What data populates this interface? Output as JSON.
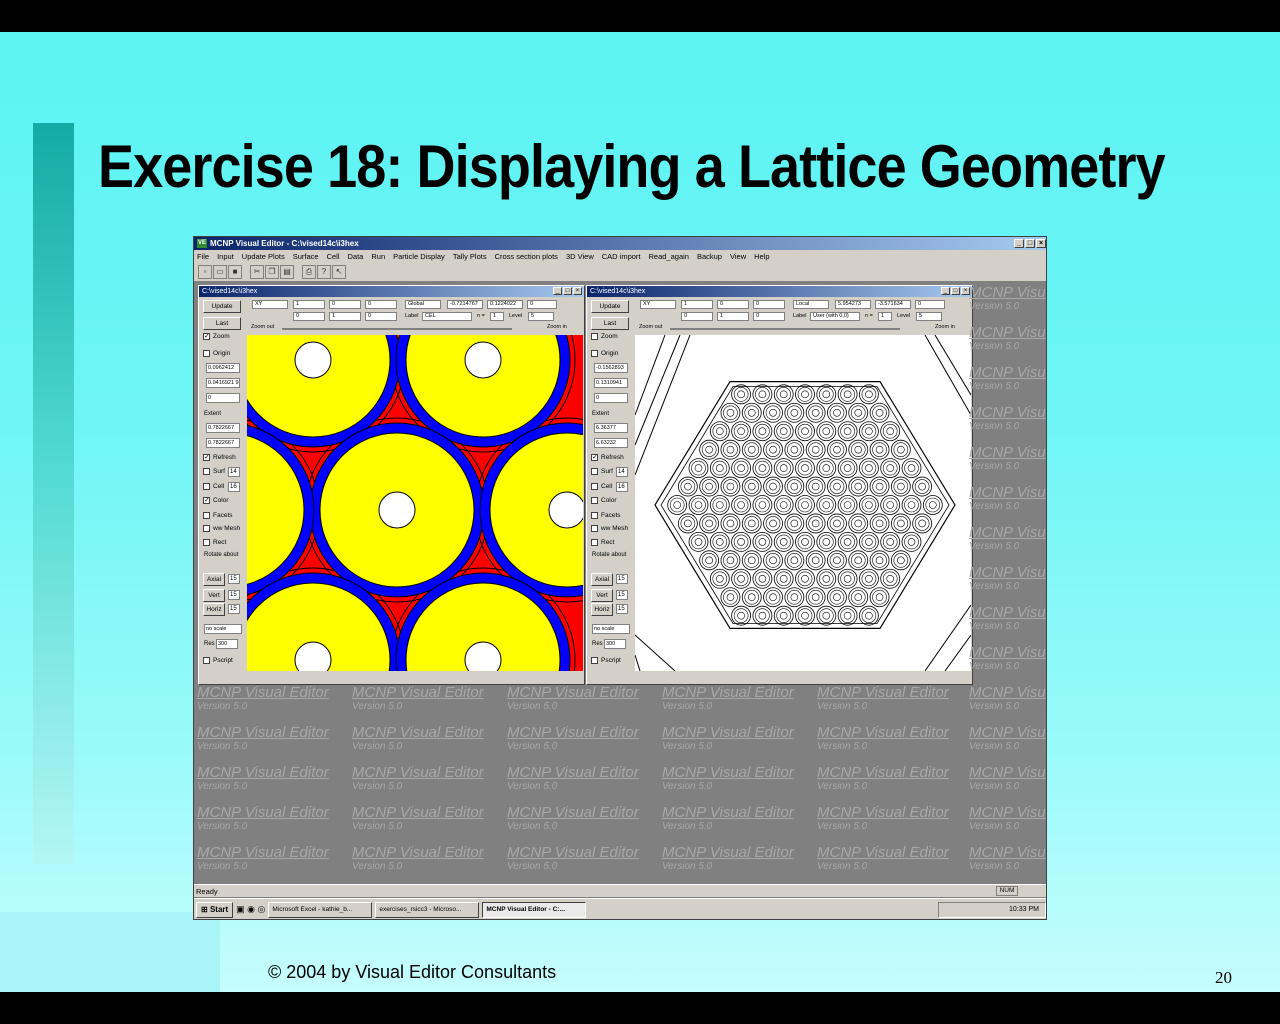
{
  "slide": {
    "title": "Exercise 18:  Displaying a Lattice Geometry",
    "copyright": "© 2004 by Visual Editor Consultants",
    "page_number": "20"
  },
  "app": {
    "title": "MCNP Visual Editor - C:\\vised14c\\i3hex",
    "logo_text": "VE",
    "window_buttons": [
      "_",
      "□",
      "×"
    ],
    "menu": [
      "File",
      "Input",
      "Update Plots",
      "Surface",
      "Cell",
      "Data",
      "Run",
      "Particle Display",
      "Tally Plots",
      "Cross section plots",
      "3D View",
      "CAD import",
      "Read_again",
      "Backup",
      "View",
      "Help"
    ],
    "toolbar_icons": [
      "new-icon",
      "open-icon",
      "save-icon",
      "cut-icon",
      "copy-icon",
      "paste-icon",
      "print-icon",
      "help-icon",
      "context-help-icon"
    ]
  },
  "left_window": {
    "title": "C:\\vised14c\\i3hex",
    "update": "Update",
    "last": "Last",
    "zoom": "Zoom",
    "origin": "Origin",
    "origin_values": [
      "0.0962412",
      "0.0416921 9",
      "0"
    ],
    "extent": "Extent",
    "extent_values": [
      "0.7822667",
      "0.7822667"
    ],
    "refresh": "Refresh",
    "surf": "Surf",
    "surf_val": "14",
    "cell": "Cell",
    "cell_val": "16",
    "color": "Color",
    "facets": "Facets",
    "wwmesh": "ww Mesh",
    "rect": "Rect",
    "rotate": "Rotate about",
    "axial": "Axial",
    "axial_val": "15",
    "vert": "Vert",
    "vert_val": "15",
    "horiz": "Horiz",
    "horiz_val": "15",
    "scale": "no scale",
    "res": "Res",
    "res_val": "300",
    "pscript": "Pscript",
    "plane": "XY",
    "row1": [
      "1",
      "0",
      "0"
    ],
    "row2": [
      "0",
      "1",
      "0"
    ],
    "coord_mode": "Global",
    "coord_vals": [
      "-0.7214767",
      "0.1224022",
      "0"
    ],
    "label_text": "Label",
    "label_val": "CEL",
    "n_label": "n =",
    "n_val": "1",
    "level_label": "Level",
    "level_val": "5",
    "zoom_out": "Zoom out",
    "zoom_in": "Zoom in"
  },
  "right_window": {
    "title": "C:\\vised14c\\i3hex",
    "update": "Update",
    "last": "Last",
    "zoom": "Zoom",
    "origin": "Origin",
    "origin_values": [
      "-0.1562893",
      "0.1310941",
      "0"
    ],
    "extent": "Extent",
    "extent_values": [
      "6.36377",
      "6.63232"
    ],
    "refresh": "Refresh",
    "surf": "Surf",
    "surf_val": "14",
    "cell": "Cell",
    "cell_val": "16",
    "color": "Color",
    "facets": "Facets",
    "wwmesh": "ww Mesh",
    "rect": "Rect",
    "rotate": "Rotate about",
    "axial": "Axial",
    "axial_val": "15",
    "vert": "Vert",
    "vert_val": "15",
    "horiz": "Horiz",
    "horiz_val": "15",
    "scale": "no scale",
    "res": "Res",
    "res_val": "300",
    "pscript": "Pscript",
    "plane": "XY",
    "row1": [
      "1",
      "0",
      "0"
    ],
    "row2": [
      "0",
      "1",
      "0"
    ],
    "coord_mode": "Local",
    "coord_vals": [
      "5.954273",
      "-3.571634",
      "0"
    ],
    "label_text": "Label",
    "label_val": "User (with 0,0)",
    "n_label": "n =",
    "n_val": "1",
    "level_label": "Level",
    "level_val": "5",
    "zoom_out": "Zoom out",
    "zoom_in": "Zoom in"
  },
  "watermark": {
    "line1": "MCNP Visual Editor",
    "line2": "Version 5.0"
  },
  "status": {
    "text": "Ready",
    "num": "NUM"
  },
  "taskbar": {
    "start": "Start",
    "tasks": [
      "Microsoft Excel - kathie_b...",
      "exercises_rsicc3 - Microso...",
      "MCNP Visual Editor - C:..."
    ],
    "time": "10:33 PM"
  },
  "colors": {
    "fill_red": "#ff0000",
    "fill_yellow": "#ffff00",
    "fill_blue": "#0000ff",
    "slide_bg": "#6ef5f5"
  }
}
